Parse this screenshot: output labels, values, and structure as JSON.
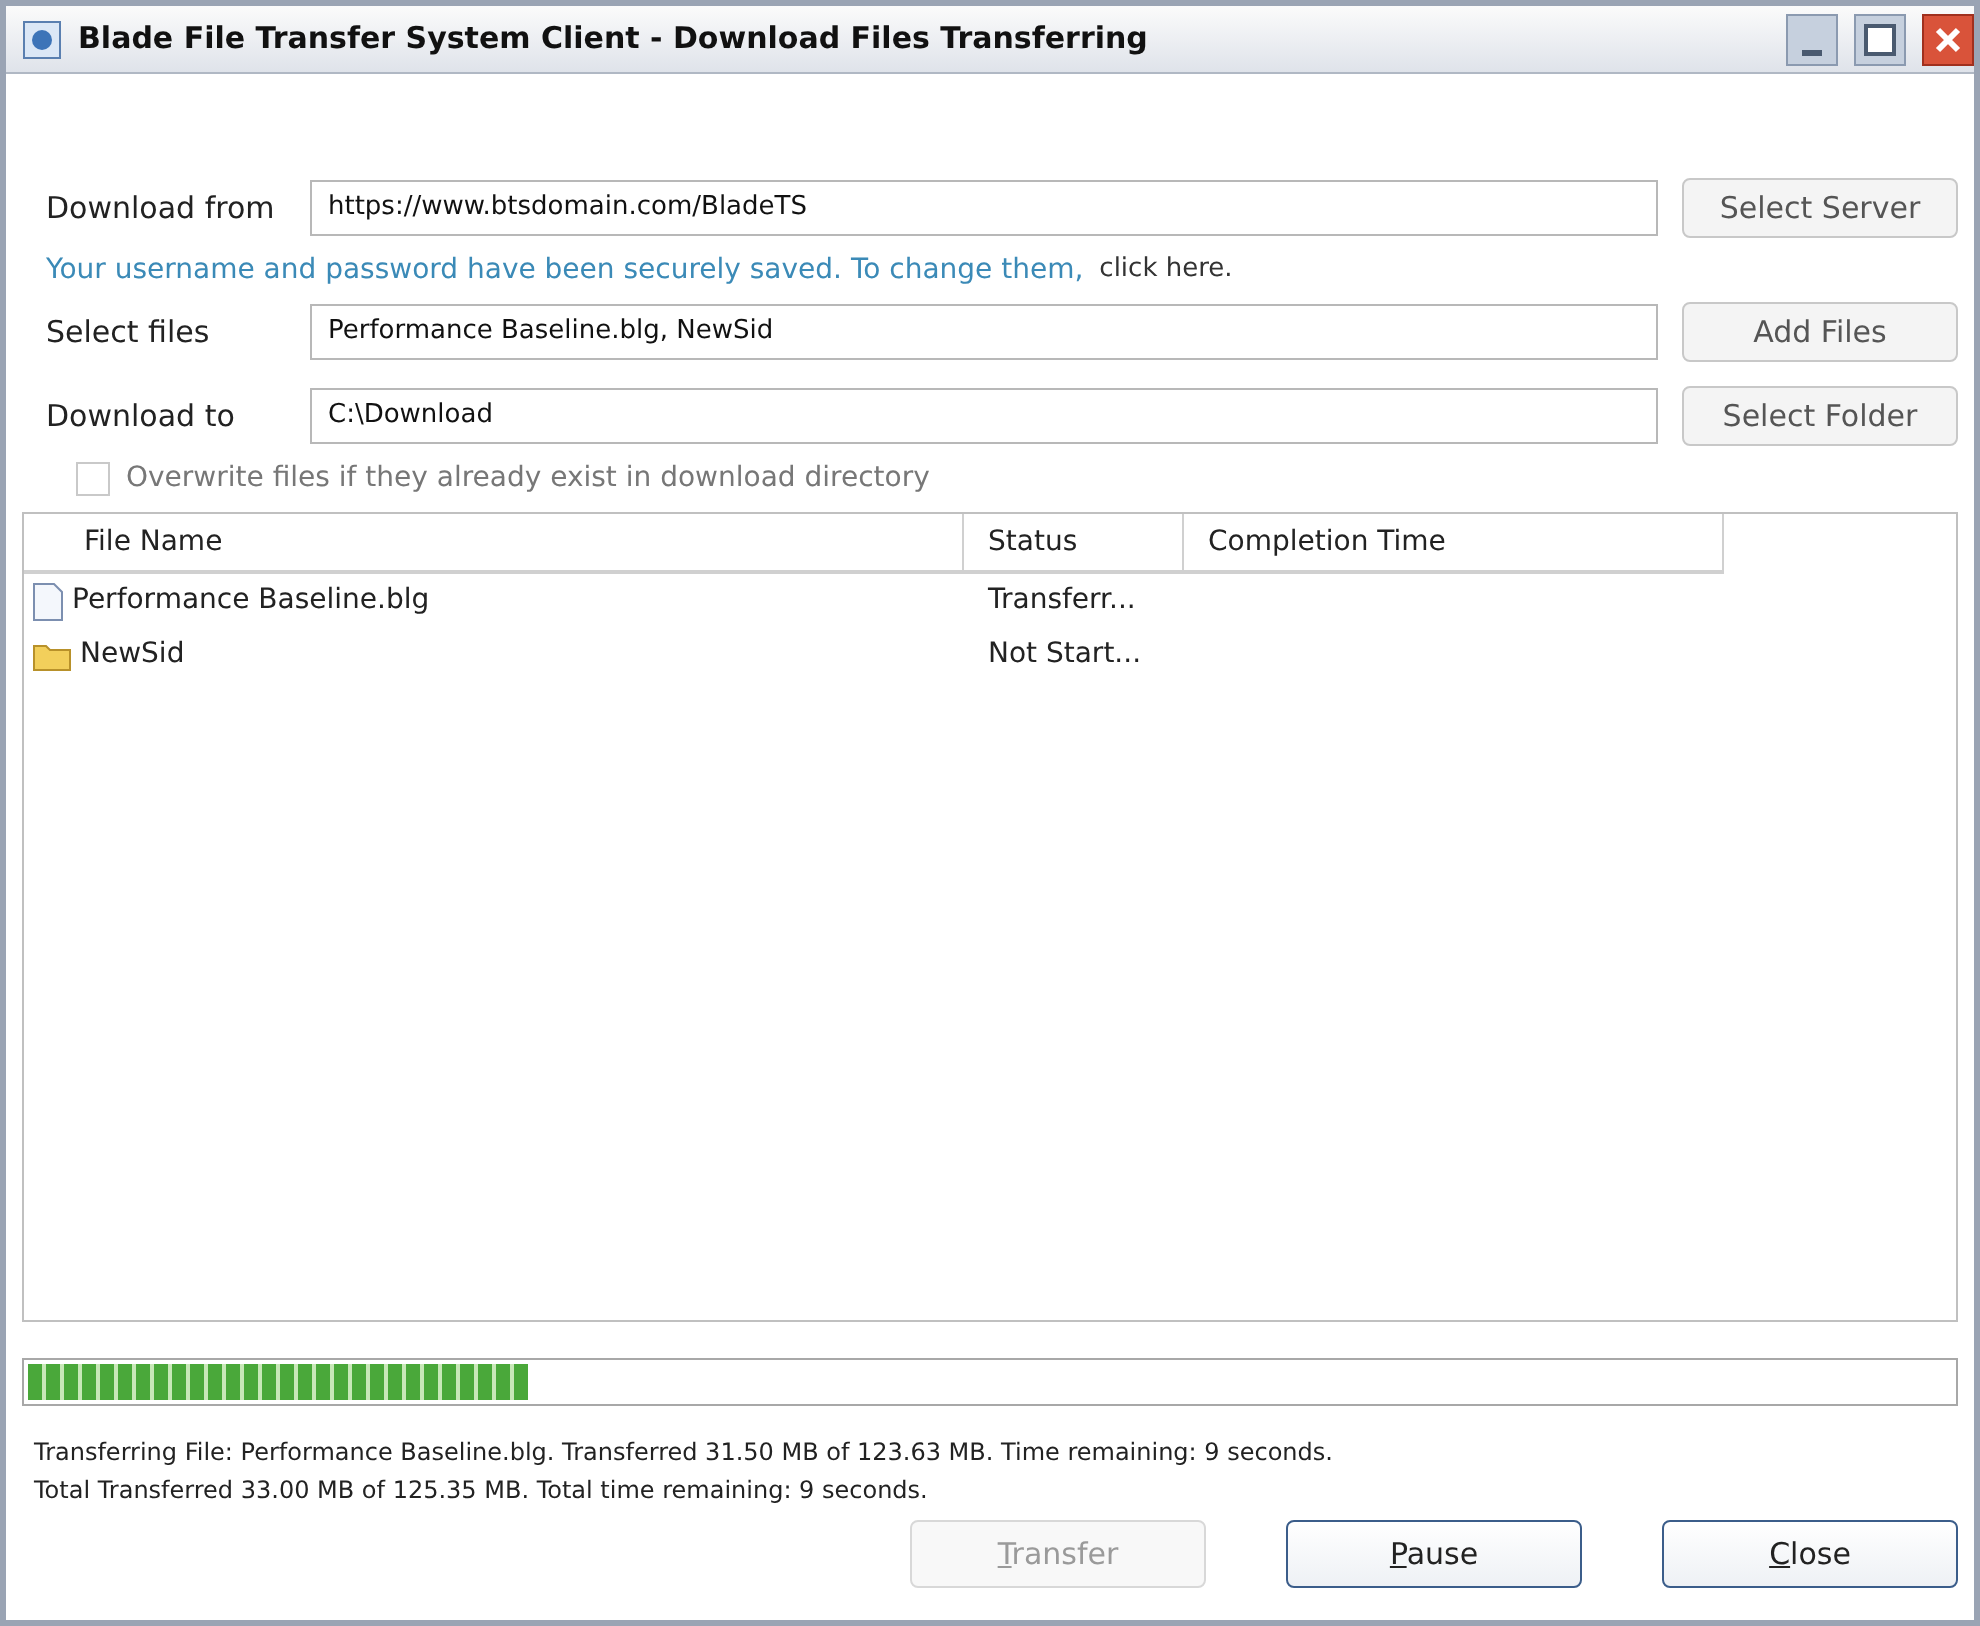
{
  "window": {
    "title": "Blade File Transfer System Client - Download Files Transferring"
  },
  "download_from": {
    "label": "Download from",
    "value": "https://www.btsdomain.com/BladeTS",
    "button": "Select Server"
  },
  "saved_notice": {
    "text": "Your username and password have been securely saved. To change them,",
    "link": "click here."
  },
  "select_files": {
    "label": "Select files",
    "value": "Performance Baseline.blg, NewSid",
    "button": "Add Files"
  },
  "download_to": {
    "label": "Download to",
    "value": "C:\\Download",
    "button": "Select Folder"
  },
  "overwrite": {
    "label": "Overwrite files if they already exist in download directory",
    "checked": false
  },
  "table": {
    "columns": [
      "File Name",
      "Status",
      "Completion Time"
    ],
    "rows": [
      {
        "kind": "file",
        "name": "Performance Baseline.blg",
        "status": "Transferr..."
      },
      {
        "kind": "folder",
        "name": "NewSid",
        "status": "Not Start..."
      }
    ]
  },
  "progress": {
    "level": 0.26
  },
  "status_lines": [
    "Transferring File: Performance Baseline.blg. Transferred 31.50 MB of 123.63 MB. Time remaining: 9 seconds.",
    "Total Transferred 33.00 MB of 125.35 MB. Total time remaining: 9 seconds."
  ],
  "buttons": [
    {
      "label": "Transfer",
      "disabled": true
    },
    {
      "label": "Pause",
      "disabled": false
    },
    {
      "label": "Close",
      "disabled": false
    }
  ]
}
